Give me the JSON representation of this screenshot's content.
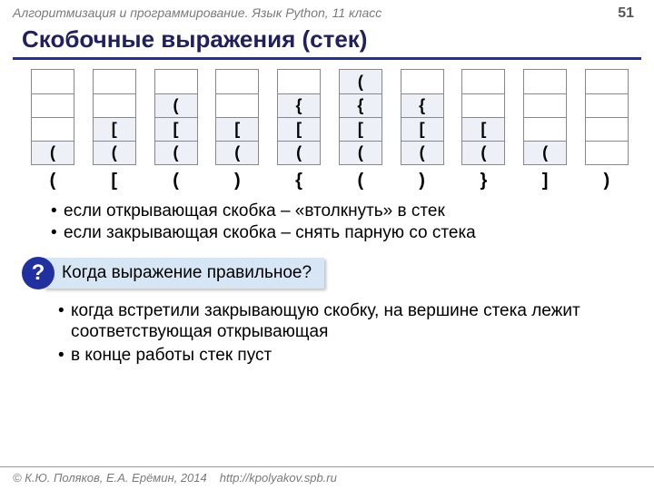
{
  "header": "Алгоритмизация и программирование. Язык Python, 11 класс",
  "page_number": "51",
  "title": "Скобочные выражения (стек)",
  "stacks": [
    {
      "cells": [
        "",
        "",
        "",
        "("
      ],
      "label": "("
    },
    {
      "cells": [
        "",
        "",
        "[",
        "("
      ],
      "label": "["
    },
    {
      "cells": [
        "",
        "(",
        "[",
        "("
      ],
      "label": "("
    },
    {
      "cells": [
        "",
        "",
        "[",
        "("
      ],
      "label": ")"
    },
    {
      "cells": [
        "",
        "{",
        "[",
        "("
      ],
      "label": "{"
    },
    {
      "cells": [
        "(",
        "{",
        "[",
        "("
      ],
      "label": "("
    },
    {
      "cells": [
        "",
        "{",
        "[",
        "("
      ],
      "label": ")"
    },
    {
      "cells": [
        "",
        "",
        "[",
        "("
      ],
      "label": "}"
    },
    {
      "cells": [
        "",
        "",
        "",
        "("
      ],
      "label": "]"
    },
    {
      "cells": [
        "",
        "",
        "",
        ""
      ],
      "label": ")"
    }
  ],
  "bullets1": [
    "если открывающая скобка – «втолкнуть» в стек",
    "если закрывающая скобка – снять парную со стека"
  ],
  "question_mark": "?",
  "question_text": "Когда выражение правильное?",
  "bullets2": [
    "когда встретили закрывающую скобку, на вершине стека лежит соответствующая открывающая",
    "в конце работы стек пуст"
  ],
  "footer_copyright": "© К.Ю. Поляков, Е.А. Ерёмин, 2014",
  "footer_url": "http://kpolyakov.spb.ru"
}
